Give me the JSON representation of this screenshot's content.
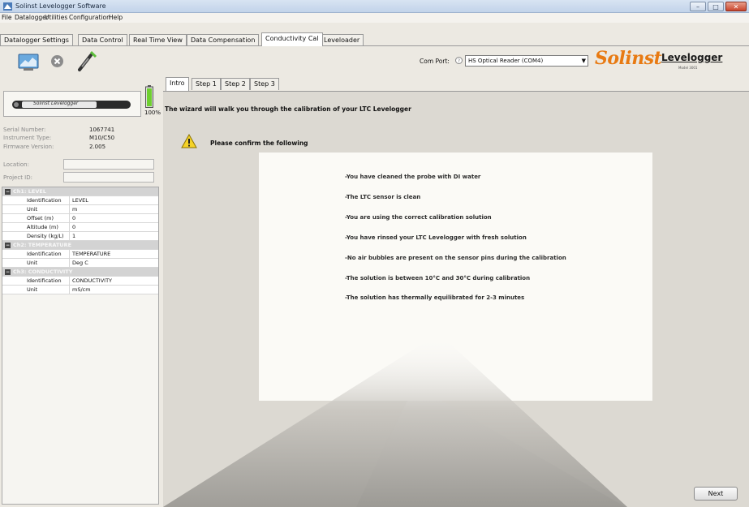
{
  "window": {
    "title": "Solinst Levelogger Software",
    "minimize": "–",
    "maximize": "□",
    "close": "✕"
  },
  "menu": [
    "File",
    "Datalogger",
    "Utilities",
    "Configuration",
    "Help"
  ],
  "main_tabs": [
    "Datalogger Settings",
    "Data Control",
    "Real Time View",
    "Data Compensation",
    "Conductivity Cal",
    "Leveloader"
  ],
  "active_main_tab": "Conductivity Cal",
  "toolbar": {
    "com_port_label": "Com Port:",
    "com_port_value": "HS Optical Reader (COM4)",
    "brand_logo": "Solinst",
    "product_logo": "Levelogger",
    "product_logo_sub": "Model 3001",
    "icons": [
      "retrieve-icon",
      "stop-icon",
      "probe-connect-icon"
    ]
  },
  "device": {
    "label": "Solinst Levelogger",
    "battery_pct": "100%",
    "battery_level": 1.0,
    "serial_label": "Serial Number:",
    "serial_value": "1067741",
    "type_label": "Instrument Type:",
    "type_value": "M10/C50",
    "firmware_label": "Firmware Version:",
    "firmware_value": "2.005",
    "location_label": "Location:",
    "location_value": "",
    "project_label": "Project ID:",
    "project_value": ""
  },
  "channels": [
    {
      "header": "Ch1: LEVEL",
      "rows": [
        [
          "Identification",
          "LEVEL"
        ],
        [
          "Unit",
          "m"
        ],
        [
          "Offset (m)",
          "0"
        ],
        [
          "Altitude (m)",
          "0"
        ],
        [
          "Density (kg/L)",
          "1"
        ]
      ]
    },
    {
      "header": "Ch2: TEMPERATURE",
      "rows": [
        [
          "Identification",
          "TEMPERATURE"
        ],
        [
          "Unit",
          "Deg C"
        ]
      ]
    },
    {
      "header": "Ch3: CONDUCTIVITY",
      "rows": [
        [
          "Identification",
          "CONDUCTIVITY"
        ],
        [
          "Unit",
          "mS/cm"
        ]
      ]
    }
  ],
  "wizard": {
    "tabs": [
      "Intro",
      "Step 1",
      "Step 2",
      "Step 3"
    ],
    "intro": "The wizard will walk you through the calibration of your LTC Levelogger",
    "confirm": "Please confirm the following",
    "checklist": [
      "-You have cleaned the probe with DI water",
      "-The LTC sensor is clean",
      "-You are using the correct calibration solution",
      "-You have rinsed your LTC Levelogger with fresh solution",
      "-No air bubbles are present on the sensor pins during the calibration",
      "-The solution is between 10°C and 30°C during calibration",
      "-The solution has thermally equilibrated for 2-3 minutes"
    ],
    "next": "Next"
  },
  "colors": {
    "accent_orange": "#e87a12",
    "battery_green": "#6fcf2f",
    "warning_yellow": "#f5d327"
  }
}
